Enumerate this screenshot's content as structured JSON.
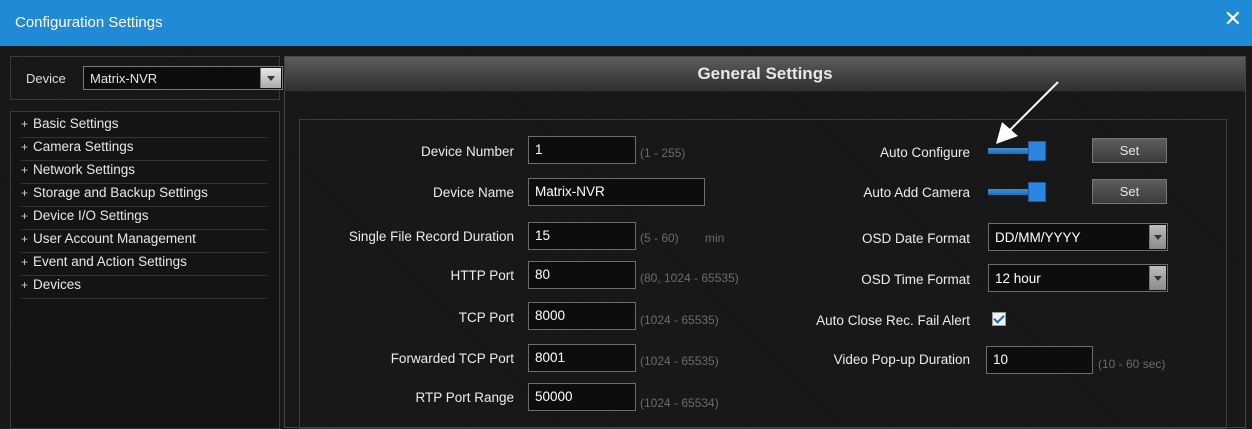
{
  "window": {
    "title": "Configuration Settings",
    "close_glyph": "✕"
  },
  "sidebar": {
    "device_label": "Device",
    "device_value": "Matrix-NVR",
    "items": [
      {
        "prefix": "+",
        "label": "Basic Settings"
      },
      {
        "prefix": "+",
        "label": "Camera Settings"
      },
      {
        "prefix": "+",
        "label": "Network Settings"
      },
      {
        "prefix": "+",
        "label": "Storage and Backup Settings"
      },
      {
        "prefix": "+",
        "label": "Device I/O Settings"
      },
      {
        "prefix": "+",
        "label": "User Account Management"
      },
      {
        "prefix": "+",
        "label": "Event and Action Settings"
      },
      {
        "prefix": "+",
        "label": "Devices"
      }
    ]
  },
  "main": {
    "header": "General Settings",
    "fields": {
      "device_number": {
        "label": "Device Number",
        "value": "1",
        "hint": "(1 - 255)"
      },
      "device_name": {
        "label": "Device Name",
        "value": "Matrix-NVR"
      },
      "record_duration": {
        "label": "Single File Record Duration",
        "value": "15",
        "hint": "(5 - 60)",
        "unit": "min"
      },
      "http_port": {
        "label": "HTTP Port",
        "value": "80",
        "hint": "(80, 1024 - 65535)"
      },
      "tcp_port": {
        "label": "TCP Port",
        "value": "8000",
        "hint": "(1024 - 65535)"
      },
      "forwarded_tcp_port": {
        "label": "Forwarded TCP Port",
        "value": "8001",
        "hint": "(1024 - 65535)"
      },
      "rtp_port_range": {
        "label": "RTP Port Range",
        "value": "50000",
        "hint": "(1024 - 65534)"
      },
      "auto_configure": {
        "label": "Auto Configure",
        "enabled": true,
        "set_label": "Set"
      },
      "auto_add_camera": {
        "label": "Auto Add Camera",
        "enabled": true,
        "set_label": "Set"
      },
      "osd_date_format": {
        "label": "OSD Date Format",
        "value": "DD/MM/YYYY"
      },
      "osd_time_format": {
        "label": "OSD Time Format",
        "value": "12 hour"
      },
      "auto_close_alert": {
        "label": "Auto Close Rec. Fail Alert",
        "checked": true
      },
      "video_popup_duration": {
        "label": "Video Pop-up Duration",
        "value": "10",
        "hint": "(10 - 60 sec)"
      }
    }
  },
  "colors": {
    "title_bar": "#1f8bd6",
    "accent": "#2c86e0",
    "background": "#161616"
  }
}
